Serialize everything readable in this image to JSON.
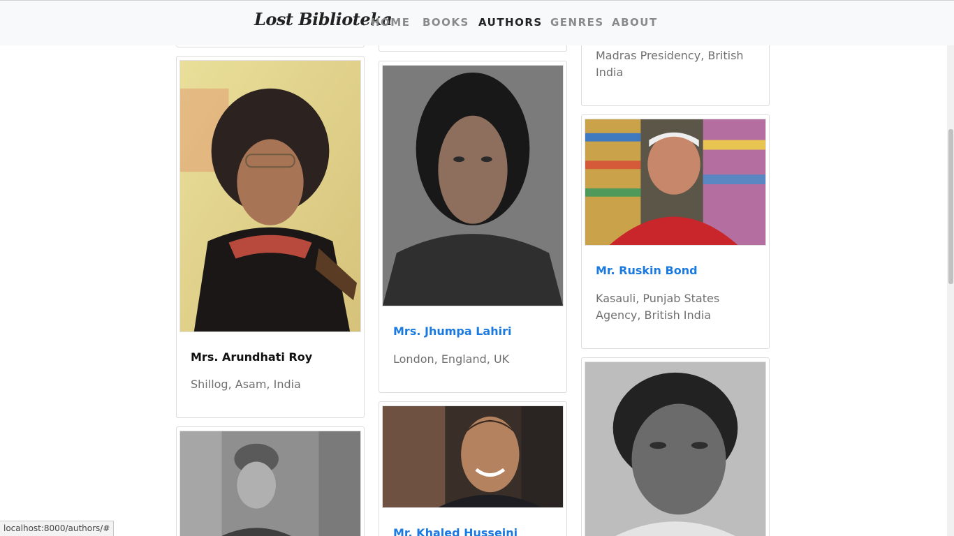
{
  "navbar": {
    "brand": "Lost Biblioteka",
    "links": [
      {
        "label": "HOME",
        "active": false
      },
      {
        "label": "BOOKS",
        "active": false
      },
      {
        "label": "AUTHORS",
        "active": true
      },
      {
        "label": "GENRES",
        "active": false
      },
      {
        "label": "ABOUT",
        "active": false
      }
    ]
  },
  "authors": {
    "madras": {
      "place": "Madras Presidency, British India"
    },
    "arundhati": {
      "name": "Mrs. Arundhati Roy",
      "place": "Shillog, Asam, India"
    },
    "jhumpa": {
      "name": "Mrs. Jhumpa Lahiri",
      "place": "London, England, UK"
    },
    "ruskin": {
      "name": "Mr. Ruskin Bond",
      "place": "Kasauli, Punjab States Agency, British India"
    },
    "khaled": {
      "name": "Mr. Khaled Husseini"
    }
  },
  "status": {
    "url": "localhost:8000/authors/#"
  },
  "colors": {
    "link": "#1a7ae2",
    "muted": "#707070",
    "navbar_bg": "#f8f9fa"
  }
}
